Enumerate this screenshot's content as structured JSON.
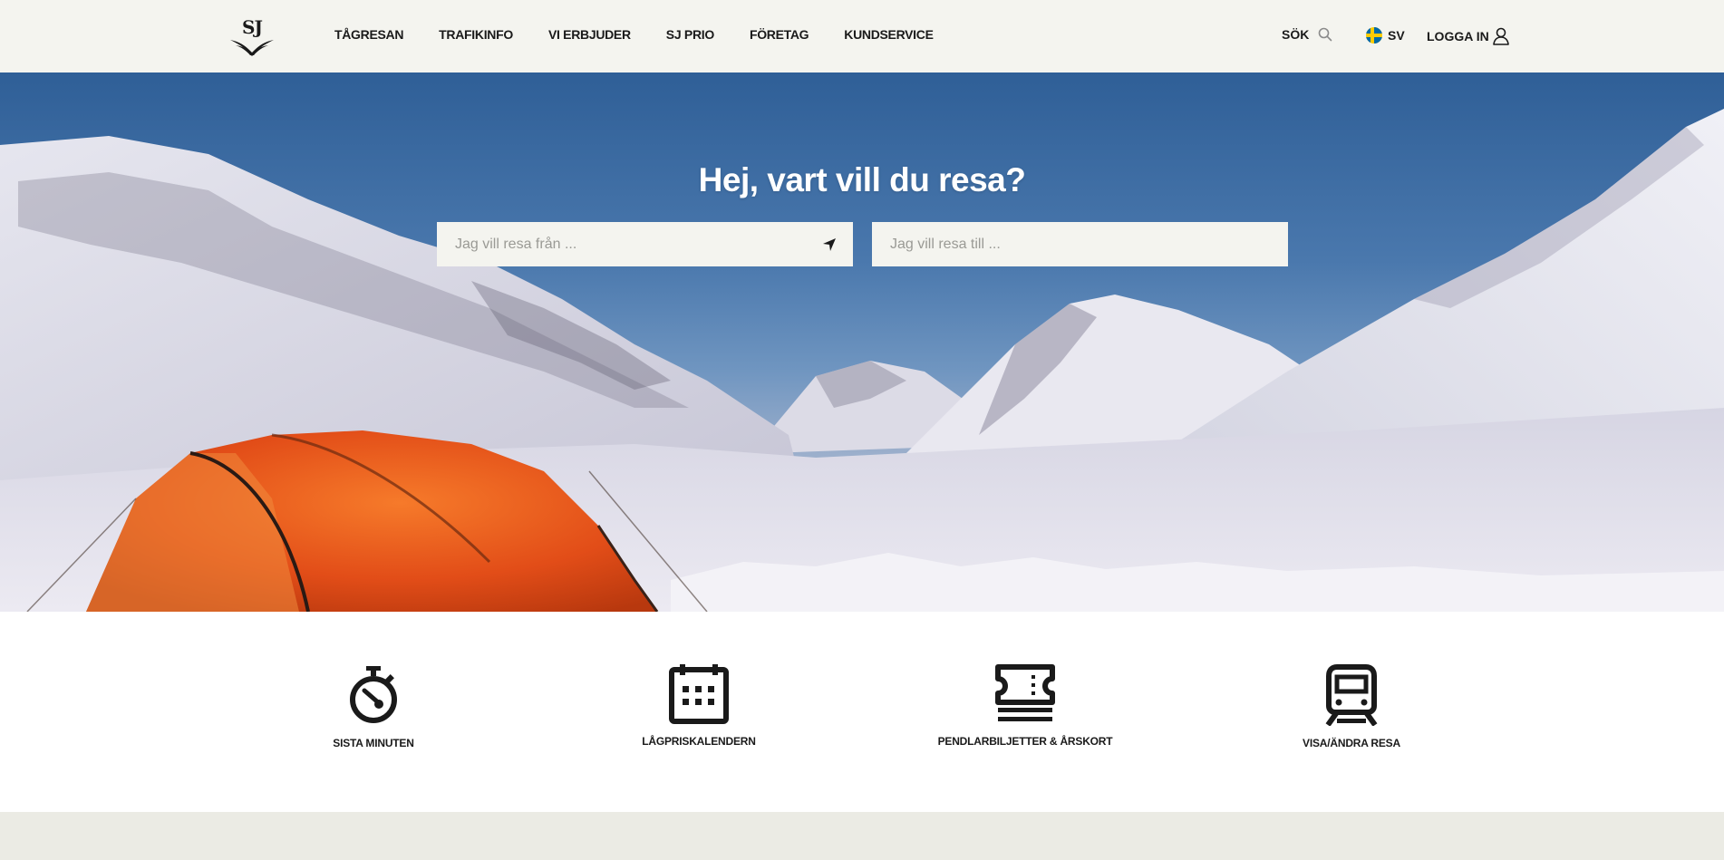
{
  "header": {
    "logo_text": "SJ",
    "nav": [
      {
        "label": "TÅGRESAN"
      },
      {
        "label": "TRAFIKINFO"
      },
      {
        "label": "VI ERBJUDER"
      },
      {
        "label": "SJ PRIO"
      },
      {
        "label": "FÖRETAG"
      },
      {
        "label": "KUNDSERVICE"
      }
    ],
    "search_label": "SÖK",
    "language_label": "SV",
    "login_label": "LOGGA IN"
  },
  "hero": {
    "title": "Hej, vart vill du resa?",
    "from_placeholder": "Jag vill resa från ...",
    "to_placeholder": "Jag vill resa till ..."
  },
  "quick_links": [
    {
      "label": "SISTA MINUTEN",
      "icon": "stopwatch-icon"
    },
    {
      "label": "LÅGPRISKALENDERN",
      "icon": "calendar-icon"
    },
    {
      "label": "PENDLARBILJETTER & ÅRSKORT",
      "icon": "ticket-icon"
    },
    {
      "label": "VISA/ÄNDRA RESA",
      "icon": "train-icon"
    }
  ],
  "colors": {
    "header_bg": "#f4f4ef",
    "field_bg": "#f4f4ef",
    "footer_band": "#ebebe4",
    "text": "#1a1a1a",
    "tent": "#e8541c",
    "flag_blue": "#006aa7",
    "flag_yellow": "#fecb00"
  }
}
